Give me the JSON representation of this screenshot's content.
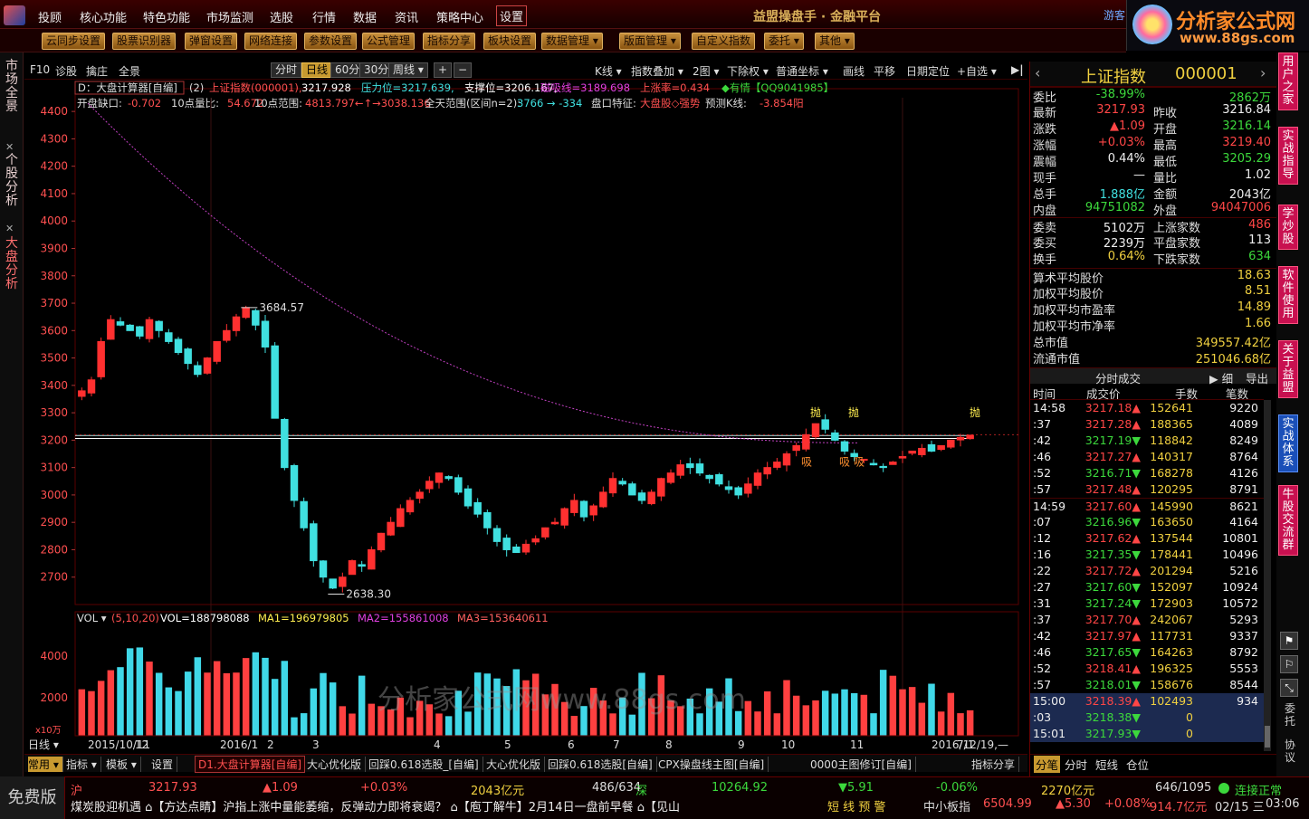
{
  "menubar": {
    "items": [
      "投顾",
      "核心功能",
      "特色功能",
      "市场监测",
      "选股",
      "行情",
      "数据",
      "资讯",
      "策略中心",
      "设置"
    ],
    "active": "设置",
    "title": "益盟操盘手 · 金融平台",
    "guest": "游客"
  },
  "brand": {
    "name": "分析家公式网",
    "url": "www.88gs.com"
  },
  "toolbar": {
    "buttons": [
      "云同步设置",
      "股票识别器",
      "弹窗设置",
      "网络连接",
      "参数设置",
      "公式管理",
      "指标分享",
      "板块设置",
      "数据管理 ▾",
      "版面管理 ▾",
      "自定义指数",
      "委托 ▾",
      "其他 ▾"
    ]
  },
  "leftside": {
    "tabs": [
      "市场全景",
      "个股分析",
      "大盘分析"
    ]
  },
  "charttb": {
    "left": [
      "F10",
      "诊股",
      "擒庄",
      "全景"
    ],
    "periods": [
      "分时",
      "日线",
      "60分",
      "30分",
      "周线 ▾"
    ],
    "active_period": "日线",
    "right": [
      "K线 ▾",
      "指数叠加 ▾",
      "2图 ▾",
      "下除权 ▾",
      "普通坐标 ▾",
      "画线",
      "平移",
      "日期定位",
      "+自选 ▾"
    ]
  },
  "indicator_bar": {
    "selector": "D：大盘计算器[自编]",
    "param": "(2)",
    "name": "上证指数(000001),",
    "price": "3217.928",
    "pressure": "压力位=3217.639,",
    "support": "支撑位=3206.167,",
    "magnet": "磁吸线=3189.698",
    "rise_rate": "上涨率=0.434",
    "qq": "◆有情【QQ9041985】"
  },
  "info_line": {
    "gap_label": "开盘缺口:",
    "gap_value": "-0.702",
    "ratio_label": "10点量比:",
    "ratio_value": "54.672",
    "range10_label": "10点范围:",
    "range10_value": "4813.797←↑→3038.136",
    "full_label": "全天范围(区间n=2):",
    "full_value": "3766 → -334",
    "feature_label": "盘口特征:",
    "feature_value": "大盘股◇强势",
    "predict_label": "预测K线:",
    "predict_value": "-3.854阳"
  },
  "chart_data": {
    "type": "candlestick",
    "title": "上证指数 000001 日线",
    "y_ticks": [
      4400,
      4300,
      4200,
      4100,
      4000,
      3900,
      3800,
      3700,
      3600,
      3500,
      3400,
      3300,
      3200,
      3100,
      3000,
      2900,
      2800,
      2700
    ],
    "ylim": [
      2600,
      4450
    ],
    "x_labels": [
      "2015/10/11",
      "12",
      "2016/1",
      "2",
      "3",
      "4",
      "5",
      "6",
      "7",
      "8",
      "9",
      "10",
      "11",
      "2016/12/19,—",
      "7/1",
      "2"
    ],
    "annotations": [
      {
        "text": "3684.57",
        "value": 3684.57
      },
      {
        "text": "2638.30",
        "value": 2638.3
      },
      {
        "text": "抛",
        "value": 3300
      },
      {
        "text": "吸",
        "value": 3120
      }
    ],
    "series_close": [
      3380,
      3420,
      3560,
      3640,
      3620,
      3600,
      3580,
      3640,
      3600,
      3560,
      3520,
      3480,
      3440,
      3500,
      3560,
      3600,
      3650,
      3684,
      3620,
      3540,
      3280,
      3100,
      2980,
      2880,
      2760,
      2700,
      2660,
      2700,
      2760,
      2740,
      2800,
      2860,
      2900,
      2950,
      2980,
      3010,
      3050,
      3080,
      3060,
      3010,
      2960,
      2930,
      2880,
      2830,
      2800,
      2790,
      2820,
      2840,
      2880,
      2900,
      2950,
      2980,
      2920,
      2960,
      3010,
      3060,
      3040,
      3000,
      2980,
      3010,
      3060,
      3080,
      3110,
      3100,
      3080,
      3060,
      3040,
      3020,
      3000,
      3040,
      3080,
      3100,
      3120,
      3150,
      3180,
      3220,
      3260,
      3240,
      3200,
      3160,
      3140,
      3130,
      3110,
      3100,
      3120,
      3140,
      3160,
      3170,
      3160,
      3180,
      3200,
      3210,
      3218
    ]
  },
  "vol_bar": {
    "label": "VOL ▾",
    "params": "(5,10,20)",
    "vol": "VOL=188798088",
    "ma1": "MA1=196979805",
    "ma2": "MA2=155861008",
    "ma3": "MA3=153640611",
    "y_ticks": [
      "4000",
      "2000"
    ],
    "unit": "x10万"
  },
  "watermark": "分析家公式网www.88gs.com",
  "quote": {
    "title": "上证指数",
    "code": "000001",
    "rows": [
      {
        "l": "委比",
        "v": "-38.99%",
        "vc": "green",
        "l2": "",
        "v2": "2862万",
        "v2c": "green"
      },
      {
        "l": "最新",
        "v": "3217.93",
        "vc": "red",
        "l2": "昨收",
        "v2": "3216.84",
        "v2c": "white"
      },
      {
        "l": "涨跌",
        "v": "▲1.09",
        "vc": "red",
        "l2": "开盘",
        "v2": "3216.14",
        "v2c": "green"
      },
      {
        "l": "涨幅",
        "v": "+0.03%",
        "vc": "red",
        "l2": "最高",
        "v2": "3219.40",
        "v2c": "red"
      },
      {
        "l": "震幅",
        "v": "0.44%",
        "vc": "white",
        "l2": "最低",
        "v2": "3205.29",
        "v2c": "green"
      },
      {
        "l": "现手",
        "v": "—",
        "vc": "white",
        "l2": "量比",
        "v2": "1.02",
        "v2c": "white"
      },
      {
        "l": "总手",
        "v": "1.888亿",
        "vc": "cyan",
        "l2": "金额",
        "v2": "2043亿",
        "v2c": "white"
      },
      {
        "l": "内盘",
        "v": "94751082",
        "vc": "green",
        "l2": "外盘",
        "v2": "94047006",
        "v2c": "red"
      },
      {
        "l": "委卖",
        "v": "5102万",
        "vc": "white",
        "l2": "上涨家数",
        "v2": "486",
        "v2c": "red"
      },
      {
        "l": "委买",
        "v": "2239万",
        "vc": "white",
        "l2": "平盘家数",
        "v2": "113",
        "v2c": "white"
      },
      {
        "l": "换手",
        "v": "0.64%",
        "vc": "yellow",
        "l2": "下跌家数",
        "v2": "634",
        "v2c": "green"
      }
    ],
    "stats": [
      {
        "l": "算术平均股价",
        "v": "18.63"
      },
      {
        "l": "加权平均股价",
        "v": "8.51"
      },
      {
        "l": "加权平均市盈率",
        "v": "14.89"
      },
      {
        "l": "加权平均市净率",
        "v": "1.66"
      },
      {
        "l": "总市值",
        "v": "349557.42亿"
      },
      {
        "l": "流通市值",
        "v": "251046.68亿"
      }
    ],
    "ticks_title": "分时成交",
    "ticks_detail": "▶ 细",
    "ticks_export": "导出",
    "ticks_headers": [
      "时间",
      "成交价",
      "手数",
      "笔数"
    ],
    "ticks": [
      {
        "t": "14:58",
        "p": "3217.18▲",
        "n": "152641",
        "c": "9220"
      },
      {
        "t": ":37",
        "p": "3217.28▲",
        "n": "188365",
        "c": "4089"
      },
      {
        "t": ":42",
        "p": "3217.19▼",
        "n": "118842",
        "c": "8249"
      },
      {
        "t": ":46",
        "p": "3217.27▲",
        "n": "140317",
        "c": "8764"
      },
      {
        "t": ":52",
        "p": "3216.71▼",
        "n": "168278",
        "c": "4126"
      },
      {
        "t": ":57",
        "p": "3217.48▲",
        "n": "120295",
        "c": "8791"
      },
      {
        "t": "14:59",
        "p": "3217.60▲",
        "n": "145990",
        "c": "8621"
      },
      {
        "t": ":07",
        "p": "3216.96▼",
        "n": "163650",
        "c": "4164"
      },
      {
        "t": ":12",
        "p": "3217.62▲",
        "n": "137544",
        "c": "10801"
      },
      {
        "t": ":16",
        "p": "3217.35▼",
        "n": "178441",
        "c": "10496"
      },
      {
        "t": ":22",
        "p": "3217.72▲",
        "n": "201294",
        "c": "5216"
      },
      {
        "t": ":27",
        "p": "3217.60▼",
        "n": "152097",
        "c": "10924"
      },
      {
        "t": ":31",
        "p": "3217.24▼",
        "n": "172903",
        "c": "10572"
      },
      {
        "t": ":37",
        "p": "3217.70▲",
        "n": "242067",
        "c": "5293"
      },
      {
        "t": ":42",
        "p": "3217.97▲",
        "n": "117731",
        "c": "9337"
      },
      {
        "t": ":46",
        "p": "3217.65▼",
        "n": "164263",
        "c": "8792"
      },
      {
        "t": ":52",
        "p": "3218.41▲",
        "n": "196325",
        "c": "5553"
      },
      {
        "t": ":57",
        "p": "3218.01▼",
        "n": "158676",
        "c": "8544"
      },
      {
        "t": "15:00",
        "p": "3218.39▲",
        "n": "102493",
        "c": "934"
      },
      {
        "t": ":03",
        "p": "3218.38▼",
        "n": "0",
        "c": ""
      },
      {
        "t": "15:01",
        "p": "3217.93▼",
        "n": "0",
        "c": ""
      }
    ],
    "bottom_tabs": [
      "分笔",
      "分时",
      "短线",
      "仓位"
    ]
  },
  "rightside": {
    "buttons": [
      "用户之家",
      "实战指导",
      "学炒股",
      "软件使用",
      "关于益盟",
      "实战体系",
      "牛股交流群"
    ],
    "bottom": [
      "委托",
      "协议"
    ]
  },
  "bottom_tabs": [
    "常用 ▾",
    "指标 ▾",
    "模板 ▾",
    "设置",
    "D1.大盘计算器[自编]",
    "大心优化版",
    "回踩0.618选股_[自编]",
    "大心优化版",
    "回踩0.618选股[自编]",
    "CPX操盘线主图[自编]",
    "0000主图修订[自编]",
    "指标分享"
  ],
  "status": {
    "free": "免费版",
    "sh_label": "沪",
    "sh_price": "3217.93",
    "sh_chg": "▲1.09",
    "sh_pct": "+0.03%",
    "sh_amt": "2043亿元",
    "sh_ud": "486/634",
    "sz_label": "深",
    "sz_price": "10264.92",
    "sz_chg": "▼5.91",
    "sz_pct": "-0.06%",
    "sz_amt": "2270亿元",
    "sz_ud": "646/1095",
    "conn": "连接正常",
    "news": "煤炭股迎机遇  ⌂【方达点睛】沪指上涨中量能萎缩，反弹动力即将衰竭？  ⌂【庖丁解牛】2月14日一盘前早餐  ⌂【见山",
    "short": "短 线 预 警",
    "zxb_label": "中小板指",
    "zxb_price": "6504.99",
    "zxb_chg": "▲5.30",
    "zxb_pct": "+0.08%",
    "zxb_amt": "914.7亿元",
    "date": "02/15 三",
    "time": "03:06"
  }
}
